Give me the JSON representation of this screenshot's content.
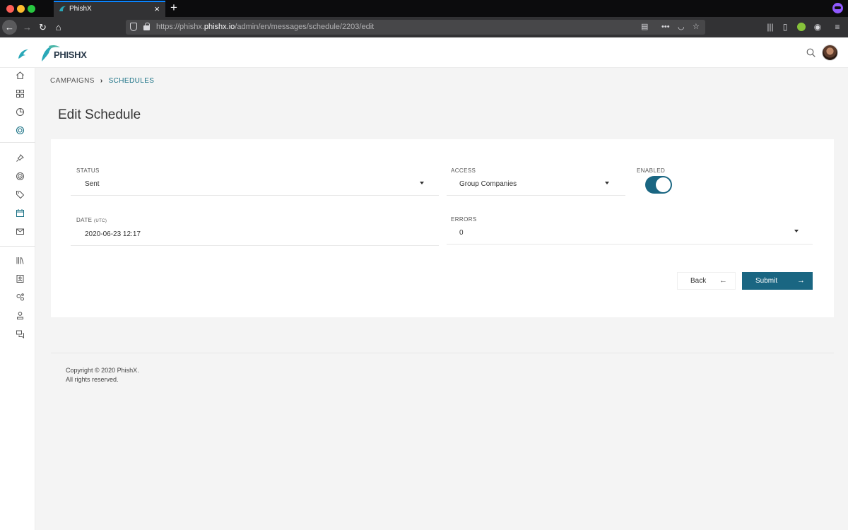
{
  "browser": {
    "tab_title": "PhishX",
    "url_prefix": "https://phishx.",
    "url_domain": "phishx.io",
    "url_path": "/admin/en/messages/schedule/2203/edit"
  },
  "header": {
    "logo_text": "PHISHX"
  },
  "breadcrumb": {
    "items": [
      "CAMPAIGNS",
      "SCHEDULES"
    ]
  },
  "page": {
    "title": "Edit Schedule"
  },
  "form": {
    "status": {
      "label": "STATUS",
      "value": "Sent"
    },
    "access": {
      "label": "ACCESS",
      "value": "Group Companies"
    },
    "enabled": {
      "label": "ENABLED",
      "on": true
    },
    "date": {
      "label": "DATE",
      "label_suffix": "(UTC)",
      "value": "2020-06-23 12:17"
    },
    "errors": {
      "label": "ERRORS",
      "value": "0"
    }
  },
  "actions": {
    "back_label": "Back",
    "submit_label": "Submit"
  },
  "footer": {
    "line1": "Copyright © 2020 PhishX.",
    "line2": "All rights reserved."
  },
  "colors": {
    "accent": "#1a6682",
    "breadcrumb_active": "#1a7185"
  }
}
